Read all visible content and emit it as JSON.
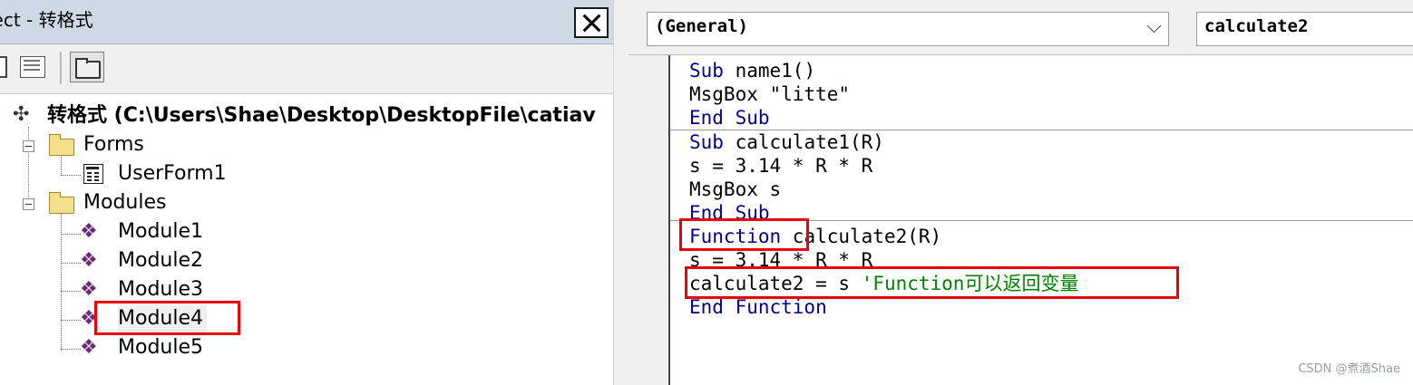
{
  "project": {
    "title": "ject - 转格式",
    "root_label": "转格式 (C:\\Users\\Shae\\Desktop\\DesktopFile\\catiav",
    "folders": [
      {
        "label": "Forms",
        "items": [
          "UserForm1"
        ]
      },
      {
        "label": "Modules",
        "items": [
          "Module1",
          "Module2",
          "Module3",
          "Module4",
          "Module5"
        ]
      }
    ],
    "selected_module": "Module4"
  },
  "code": {
    "object_combo": "(General)",
    "procedure_combo": "calculate2",
    "procedures": [
      {
        "lines": [
          {
            "kw": "Sub",
            "text": " name1()"
          },
          {
            "kw": "",
            "text": "MsgBox \"litte\""
          },
          {
            "kw": "End Sub",
            "text": ""
          }
        ]
      },
      {
        "lines": [
          {
            "kw": "Sub",
            "text": " calculate1(R)"
          },
          {
            "kw": "",
            "text": "s = 3.14 * R * R"
          },
          {
            "kw": "",
            "text": "MsgBox s"
          },
          {
            "kw": "End Sub",
            "text": ""
          }
        ]
      },
      {
        "lines": [
          {
            "kw": "Function",
            "text": " calculate2(R)"
          },
          {
            "kw": "",
            "text": "s = 3.14 * R * R"
          },
          {
            "kw": "",
            "text": "calculate2 = s ",
            "comment": "'Function可以返回变量"
          },
          {
            "kw": "End Function",
            "text": ""
          }
        ]
      }
    ]
  },
  "watermark": "CSDN @煮酒Shae",
  "colors": {
    "keyword": "#00008b",
    "comment": "#008000",
    "highlight": "#e8000b",
    "title_bar": "#cfd9e6"
  }
}
